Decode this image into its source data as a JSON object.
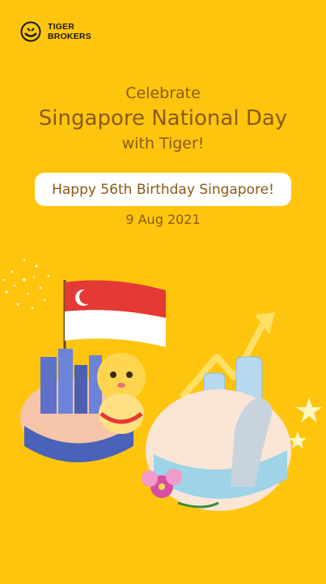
{
  "brand": {
    "name_line1": "TIGER",
    "name_line2": "BROKERS"
  },
  "headline": {
    "line1": "Celebrate",
    "line2": "Singapore National Day",
    "line3": "with Tiger!"
  },
  "pill_text": "Happy 56th Birthday Singapore!",
  "date": "9 Aug 2021",
  "colors": {
    "background": "#FFC50E",
    "text": "#8a5a12",
    "pill": "#ffffff"
  }
}
